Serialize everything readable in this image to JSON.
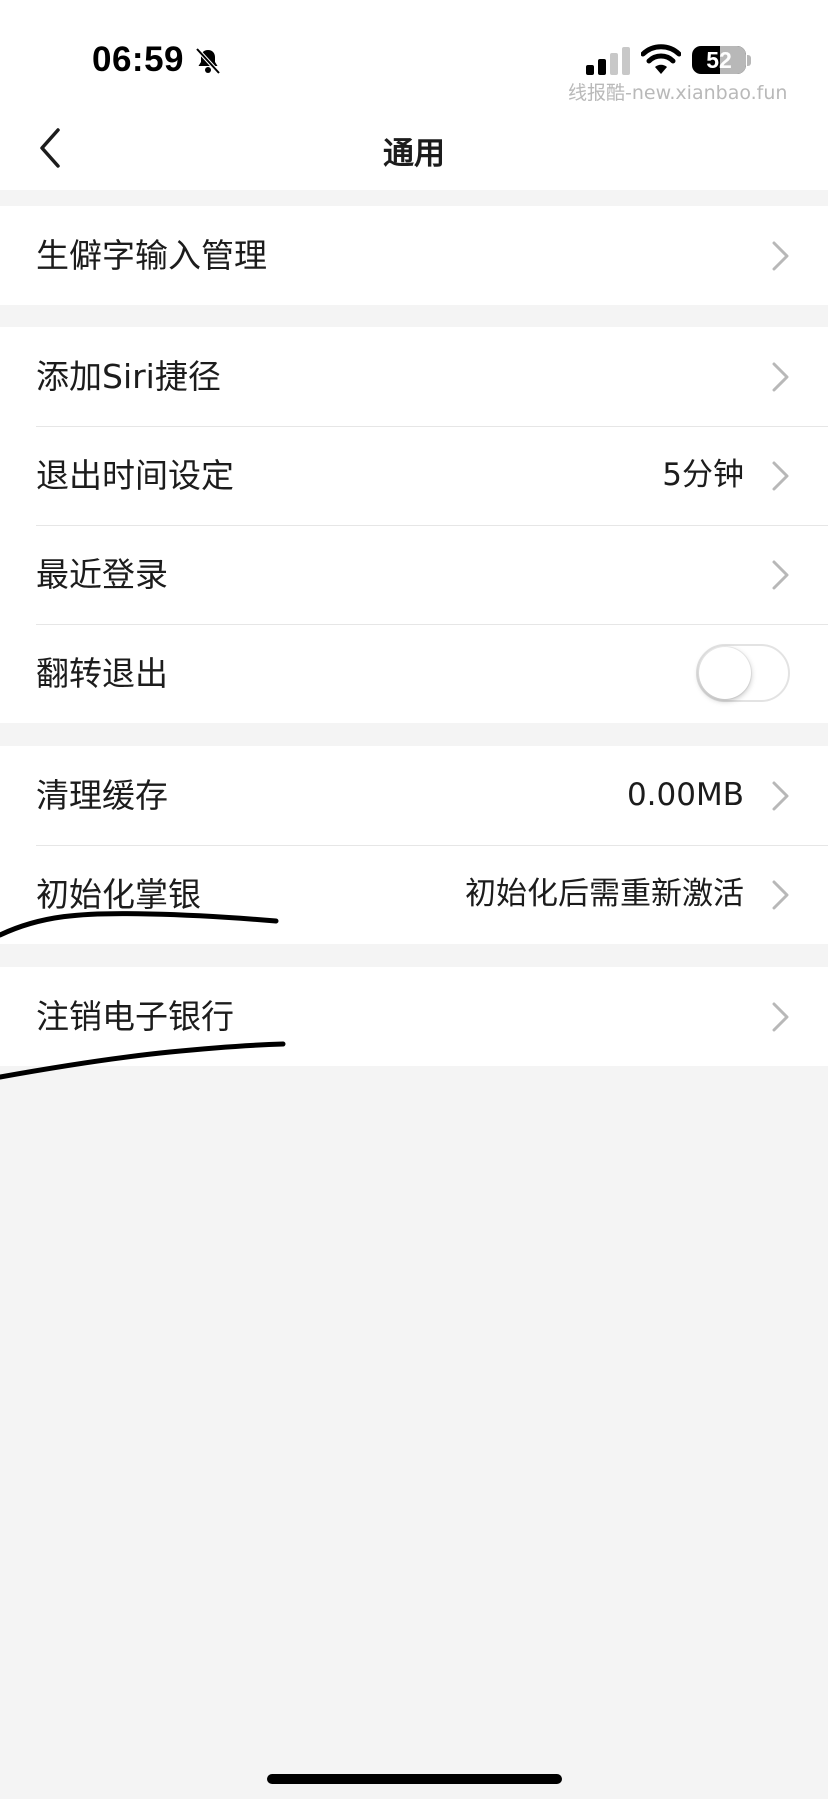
{
  "status_bar": {
    "time": "06:59",
    "battery": "52",
    "battery_level": 0.52,
    "icons": [
      "bell-muted-icon",
      "cellular-signal-icon",
      "wifi-icon",
      "battery-icon"
    ]
  },
  "watermark": "线报酷-new.xianbao.fun",
  "nav": {
    "title": "通用",
    "back_icon": "chevron-left-icon"
  },
  "groups": [
    {
      "rows": [
        {
          "label": "生僻字输入管理",
          "accessory": "chevron"
        }
      ]
    },
    {
      "rows": [
        {
          "label": "添加Siri捷径",
          "accessory": "chevron"
        },
        {
          "label": "退出时间设定",
          "value": "5分钟",
          "accessory": "chevron"
        },
        {
          "label": "最近登录",
          "accessory": "chevron"
        },
        {
          "label": "翻转退出",
          "accessory": "toggle",
          "toggle_on": false
        }
      ]
    },
    {
      "rows": [
        {
          "label": "清理缓存",
          "value": "0.00MB",
          "accessory": "chevron"
        },
        {
          "label": "初始化掌银",
          "value": "初始化后需重新激活",
          "accessory": "chevron"
        }
      ]
    },
    {
      "rows": [
        {
          "label": "注销电子银行",
          "accessory": "chevron"
        }
      ]
    }
  ],
  "colors": {
    "background": "#f4f4f4",
    "surface": "#ffffff",
    "text": "#1c1c1c",
    "chevron": "#b8b8b8",
    "handwritten_mark": "#000000"
  }
}
